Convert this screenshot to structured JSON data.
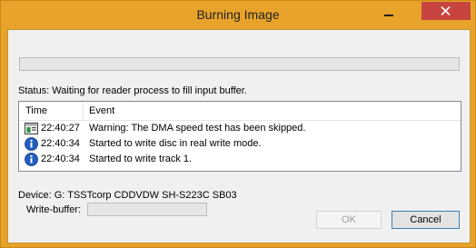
{
  "window": {
    "title": "Burning Image"
  },
  "progress": {
    "value": 0
  },
  "status": {
    "text": "Status: Waiting for reader process to fill input buffer."
  },
  "log": {
    "columns": {
      "time": "Time",
      "event": "Event"
    },
    "rows": [
      {
        "icon": "warning-log-icon",
        "time": "22:40:27",
        "event": "Warning: The DMA speed test has been skipped."
      },
      {
        "icon": "info-icon",
        "time": "22:40:34",
        "event": "Started to write disc in real write mode."
      },
      {
        "icon": "info-icon",
        "time": "22:40:34",
        "event": "Started to write track 1."
      }
    ]
  },
  "device": {
    "text": "Device: G: TSSTcorp CDDVDW SH-S223C SB03"
  },
  "write_buffer": {
    "label": "Write-buffer:",
    "value": 0
  },
  "buttons": {
    "ok": "OK",
    "cancel": "Cancel"
  },
  "colors": {
    "title_bar": "#e8a32b",
    "close_button": "#c7443f",
    "progress_fill": "#06b025",
    "info_icon": "#1f5fbf"
  }
}
